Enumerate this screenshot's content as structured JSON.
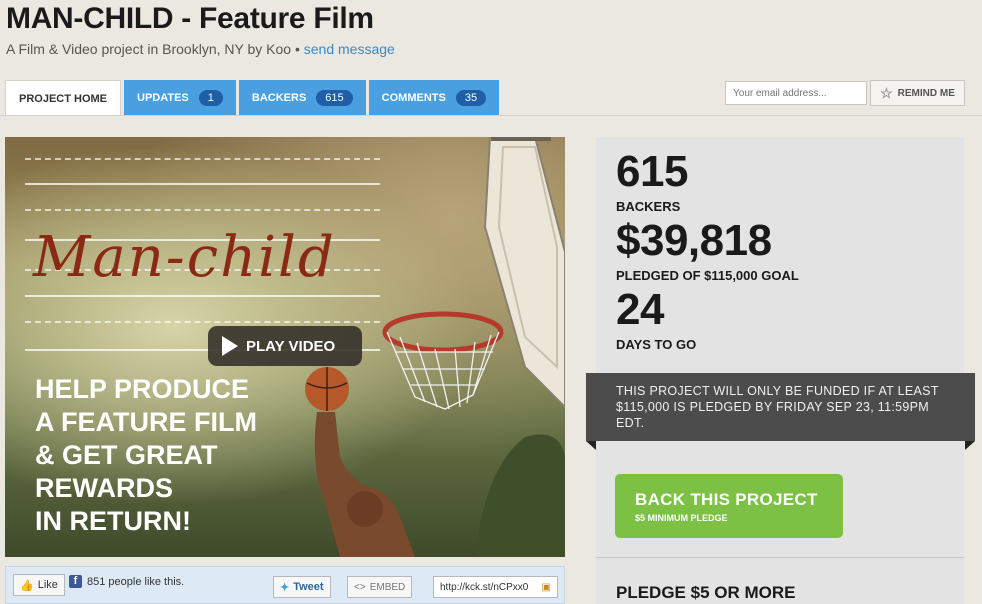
{
  "project": {
    "title": "MAN-CHILD - Feature Film",
    "subtitle": "A Film & Video project in Brooklyn, NY by Koo •",
    "send_message": "send message"
  },
  "tabs": [
    {
      "label": "PROJECT HOME",
      "count": null,
      "active": true
    },
    {
      "label": "UPDATES",
      "count": "1"
    },
    {
      "label": "BACKERS",
      "count": "615"
    },
    {
      "label": "COMMENTS",
      "count": "35"
    }
  ],
  "remind": {
    "placeholder": "Your email address...",
    "label": "REMIND ME"
  },
  "video": {
    "logo_text": "Man-child",
    "play_label": "PLAY VIDEO",
    "tagline": [
      "HELP PRODUCE",
      "A FEATURE FILM",
      "& GET GREAT",
      "REWARDS",
      "IN RETURN!"
    ]
  },
  "share": {
    "like_label": "Like",
    "like_count": "851 people like this.",
    "tweet_label": "Tweet",
    "embed_label": "EMBED",
    "short_url": "http://kck.st/nCPxx0"
  },
  "stats": {
    "backers_value": "615",
    "backers_label": "BACKERS",
    "pledged_value": "$39,818",
    "pledged_label": "PLEDGED OF $115,000 GOAL",
    "days_value": "24",
    "days_label": "DAYS TO GO"
  },
  "notice": "THIS PROJECT WILL ONLY BE FUNDED IF AT LEAST $115,000 IS PLEDGED BY FRIDAY SEP 23, 11:59PM EDT.",
  "back_button": {
    "label": "BACK THIS PROJECT",
    "sub": "$5 MINIMUM PLEDGE"
  },
  "pledge_tier": {
    "heading": "PLEDGE $5 OR MORE"
  },
  "colors": {
    "tab_blue": "#4a9fe0",
    "count_pill": "#1e5fa8",
    "back_green": "#7cc143",
    "link": "#3b88c3"
  }
}
